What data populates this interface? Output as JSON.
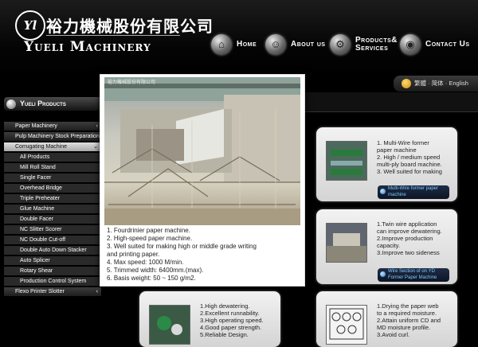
{
  "brand": {
    "logo_text": "Yl",
    "name_cn": "裕力機械股份有限公司",
    "name_en": "Yueli Machinery"
  },
  "nav": [
    {
      "label": "Home",
      "icon": "home-icon"
    },
    {
      "label": "About us",
      "icon": "about-icon"
    },
    {
      "label": "Products& Services",
      "icon": "products-icon"
    },
    {
      "label": "Contact Us",
      "icon": "globe-icon"
    }
  ],
  "language": {
    "options": "繁體 · 简体 · English"
  },
  "sidebar": {
    "title": "Yueli Products",
    "items": [
      {
        "label": "Paper Machinery",
        "type": "cat",
        "arrow": "‹"
      },
      {
        "label": "Pulp Machinery Stock Preparation",
        "type": "cat",
        "arrow": ""
      },
      {
        "label": "Corrugating Machine",
        "type": "cat-open",
        "arrow": "⌄"
      },
      {
        "label": "All Products",
        "type": "sub"
      },
      {
        "label": "Mill Roll Stand",
        "type": "sub"
      },
      {
        "label": "Single Facer",
        "type": "sub"
      },
      {
        "label": "Overhead Bridge",
        "type": "sub"
      },
      {
        "label": "Triple Preheater",
        "type": "sub"
      },
      {
        "label": "Glue Machine",
        "type": "sub"
      },
      {
        "label": "Double Facer",
        "type": "sub"
      },
      {
        "label": "NC Slitter Scorer",
        "type": "sub"
      },
      {
        "label": "NC Double Cut-off",
        "type": "sub"
      },
      {
        "label": "Double Auto Down Stacker",
        "type": "sub"
      },
      {
        "label": "Auto Splicer",
        "type": "sub"
      },
      {
        "label": "Rotary Shear",
        "type": "sub"
      },
      {
        "label": "Production Control System",
        "type": "sub"
      },
      {
        "label": "Flexo Printer Slotter",
        "type": "cat",
        "arrow": "‹"
      }
    ]
  },
  "popup": {
    "watermark": "裕力機械股份有限公司",
    "lines": [
      "1. Fourdrinier paper machine.",
      "2. High-speed paper machine.",
      "3. Well suited for making high or middle grade writing",
      "and printing paper.",
      "4. Max speed: 1000 M/min.",
      "5. Trimmed width: 6400mm.(max).",
      "6. Basis weight: 50 ~ 150 g/m2."
    ]
  },
  "cards": [
    {
      "lines": [
        "1. Multi-Wire former",
        "paper machine",
        "2. High / medium speed",
        "multi-ply board machine.",
        "3. Well suited for making"
      ],
      "tag": "Multi-Wire former paper machine"
    },
    {
      "lines": [
        "1.Twin wire application",
        "can improve dewatering.",
        "2.Improve production",
        "capacity.",
        "3.Improve two sideness"
      ],
      "tag": "Wire Section of on YD Former Paper Machine"
    },
    {
      "lines": [
        "1.High dewatering.",
        "2.Excellent runnability.",
        "3.High operating speed.",
        "4.Good paper strength.",
        "5.Reliable Design."
      ],
      "tag": ""
    },
    {
      "lines": [
        "1.Drying the paper web",
        "to a required moisture.",
        "2.Attain uniform CD and",
        "MD moisture profile.",
        "3.Avoid curl."
      ],
      "tag": ""
    }
  ]
}
